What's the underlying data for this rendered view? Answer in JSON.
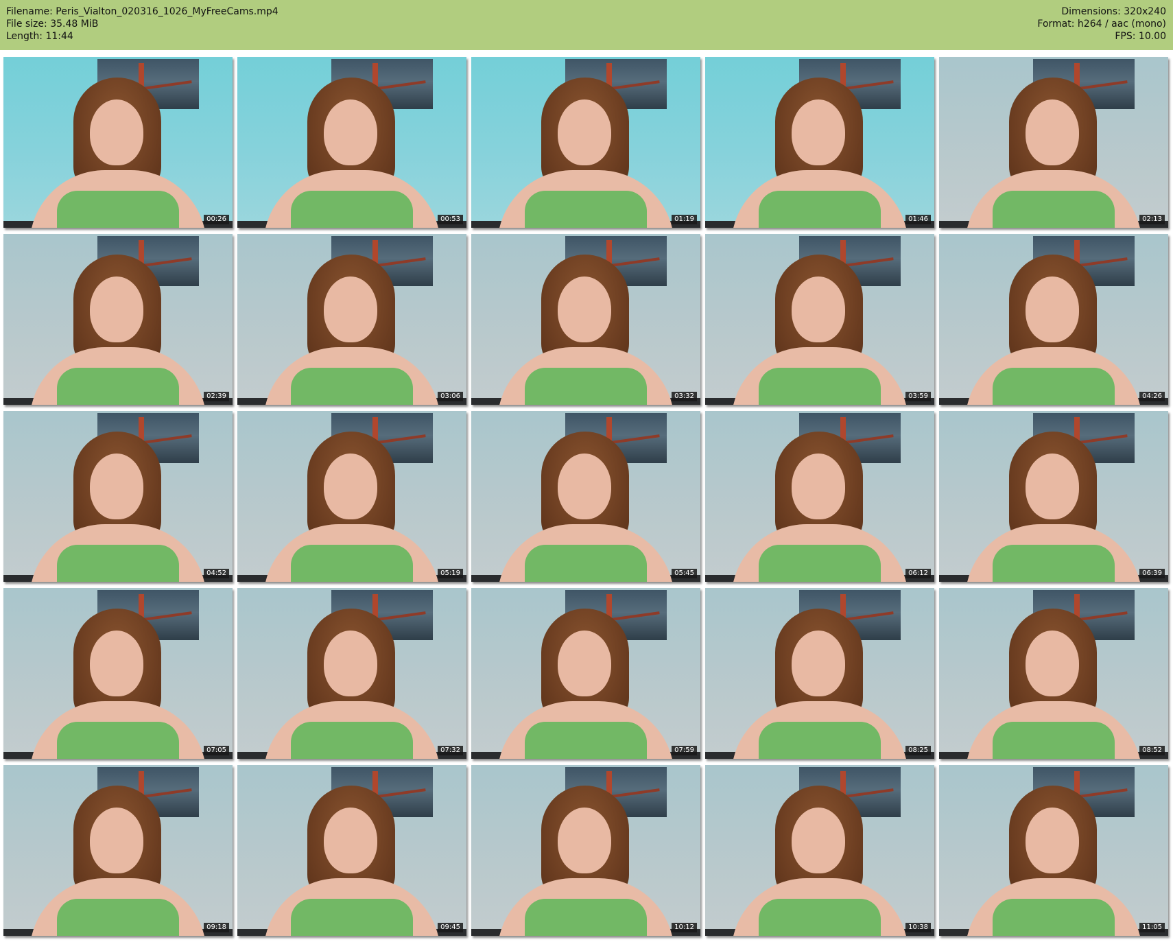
{
  "header": {
    "filename": "Filename: Peris_Vialton_020316_1026_MyFreeCams.mp4",
    "file_size": "File size: 35.48 MiB",
    "length": "Length: 11:44",
    "dimensions": "Dimensions: 320x240",
    "format": "Format: h264 / aac (mono)",
    "fps": "FPS: 10.00"
  },
  "colors": {
    "header_background": "#b1cd7f",
    "page_background": "#ffffff"
  },
  "thumbnails": [
    {
      "time": "00:26"
    },
    {
      "time": "00:53"
    },
    {
      "time": "01:19"
    },
    {
      "time": "01:46"
    },
    {
      "time": "02:13"
    },
    {
      "time": "02:39"
    },
    {
      "time": "03:06"
    },
    {
      "time": "03:32"
    },
    {
      "time": "03:59"
    },
    {
      "time": "04:26"
    },
    {
      "time": "04:52"
    },
    {
      "time": "05:19"
    },
    {
      "time": "05:45"
    },
    {
      "time": "06:12"
    },
    {
      "time": "06:39"
    },
    {
      "time": "07:05"
    },
    {
      "time": "07:32"
    },
    {
      "time": "07:59"
    },
    {
      "time": "08:25"
    },
    {
      "time": "08:52"
    },
    {
      "time": "09:18"
    },
    {
      "time": "09:45"
    },
    {
      "time": "10:12"
    },
    {
      "time": "10:38"
    },
    {
      "time": "11:05"
    }
  ]
}
